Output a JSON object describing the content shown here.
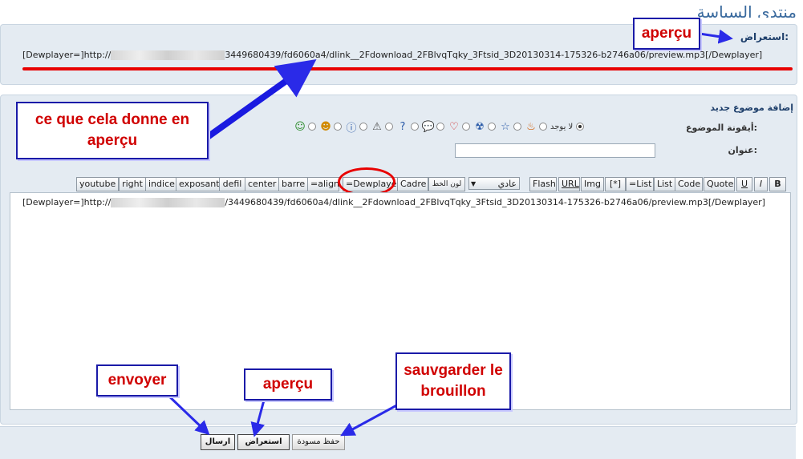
{
  "forum_title": "منتدى السياسة",
  "preview": {
    "label": "استعراض:",
    "text_prefix": "[Dewplayer=]http://",
    "text_suffix": "3449680439/fd6060a4/dlink__2Fdownload_2FBlvqTqky_3Ftsid_3D20130314-175326-b2746a06/preview.mp3[/Dewplayer]"
  },
  "editor": {
    "header": "إضافة موضوع جديد",
    "icon_label": "أيقونة الموضوع:",
    "none_label": "لا يوجد",
    "title_label": "عنوان:",
    "title_value": "",
    "icons": [
      "fire-icon",
      "star-icon",
      "radiation-icon",
      "heart-icon",
      "speech-bubble-icon",
      "question-icon",
      "warning-icon",
      "info-icon",
      "laugh-icon",
      "grin-icon"
    ],
    "toolbar": {
      "bold": "B",
      "italic": "I",
      "underline": "U",
      "quote": "Quote",
      "code": "Code",
      "list": "List",
      "list_eq": "=List",
      "star": "[*]",
      "img": "Img",
      "url": "URL",
      "flash": "Flash",
      "size_value": "عادي",
      "font_color": "لون الخط",
      "cadre": "Cadre",
      "dewplayer": "=Dewplayer",
      "align": "=align",
      "barre": "barre",
      "center": "center",
      "defil": "defil",
      "exposant": "exposant",
      "indice": "indice",
      "right": "right",
      "youtube": "youtube"
    },
    "message_prefix": "[Dewplayer=]http://",
    "message_suffix": "/3449680439/fd6060a4/dlink__2Fdownload_2FBlvqTqky_3Ftsid_3D20130314-175326-b2746a06/preview.mp3[/Dewplayer]"
  },
  "buttons": {
    "send": "ارسال",
    "preview": "استعراض",
    "draft": "حفظ مسودة"
  },
  "annotations": {
    "apercu_top": "aperçu",
    "result": "ce que cela donne en aperçu",
    "envoyer": "envoyer",
    "apercu_bottom": "aperçu",
    "sauvgarder": "sauvgarder le brouillon"
  },
  "colors": {
    "annotation_text": "#d00000",
    "arrow": "#2a2ae8",
    "panel": "#e4ebf2",
    "underline": "#e80000"
  }
}
